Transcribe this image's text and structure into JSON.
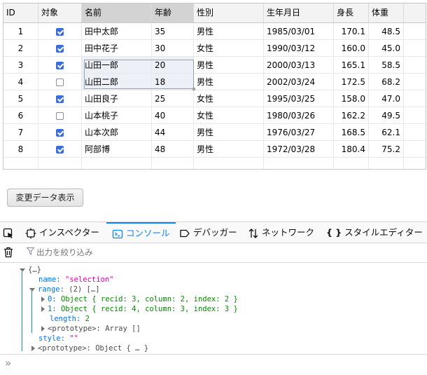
{
  "grid": {
    "columns": [
      "ID",
      "対象",
      "名前",
      "年齢",
      "性別",
      "生年月日",
      "身長",
      "体重"
    ],
    "rows": [
      {
        "id": "1",
        "checked": true,
        "name": "田中太郎",
        "age": "35",
        "gender": "男性",
        "birth": "1985/03/01",
        "height": "170.1",
        "weight": "48.5"
      },
      {
        "id": "2",
        "checked": true,
        "name": "田中花子",
        "age": "30",
        "gender": "女性",
        "birth": "1990/03/12",
        "height": "160.0",
        "weight": "45.0"
      },
      {
        "id": "3",
        "checked": true,
        "name": "山田一郎",
        "age": "20",
        "gender": "男性",
        "birth": "2000/03/13",
        "height": "165.1",
        "weight": "58.5"
      },
      {
        "id": "4",
        "checked": false,
        "name": "山田二郎",
        "age": "18",
        "gender": "男性",
        "birth": "2002/03/24",
        "height": "172.5",
        "weight": "68.2"
      },
      {
        "id": "5",
        "checked": true,
        "name": "山田良子",
        "age": "25",
        "gender": "女性",
        "birth": "1995/03/25",
        "height": "158.0",
        "weight": "47.0"
      },
      {
        "id": "6",
        "checked": false,
        "name": "山本桃子",
        "age": "40",
        "gender": "女性",
        "birth": "1980/03/26",
        "height": "162.2",
        "weight": "49.5"
      },
      {
        "id": "7",
        "checked": true,
        "name": "山本次郎",
        "age": "44",
        "gender": "男性",
        "birth": "1976/03/27",
        "height": "168.5",
        "weight": "62.1"
      },
      {
        "id": "8",
        "checked": true,
        "name": "阿部博",
        "age": "48",
        "gender": "男性",
        "birth": "1972/03/28",
        "height": "180.4",
        "weight": "75.2"
      }
    ]
  },
  "button": {
    "show_changes": "変更データ表示"
  },
  "devtools": {
    "tabs": [
      "インスペクター",
      "コンソール",
      "デバッガー",
      "ネットワーク",
      "スタイルエディター"
    ],
    "active_tab": "コンソール",
    "filter_placeholder": "出力を絞り込み",
    "console": {
      "root": "{…}",
      "name_key": "name:",
      "name_val": "\"selection\"",
      "range_key": "range:",
      "range_summary": "(2) […]",
      "item0_idx": "0:",
      "item0_obj": "Object { recid: 3, column: 2, index: 2 }",
      "item1_idx": "1:",
      "item1_obj": "Object { recid: 4, column: 3, index: 3 }",
      "length_key": "length:",
      "length_val": "2",
      "arr_proto_key": "<prototype>:",
      "arr_proto_val": "Array []",
      "style_key": "style:",
      "style_val": "\"\"",
      "obj_proto_key": "<prototype>:",
      "obj_proto_val": "Object { … }"
    },
    "prompt_symbol": "»"
  },
  "colors": {
    "accent": "#0a84ff",
    "check": "#3b6fd6",
    "string": "#dd00a9",
    "key": "#0074e8"
  }
}
